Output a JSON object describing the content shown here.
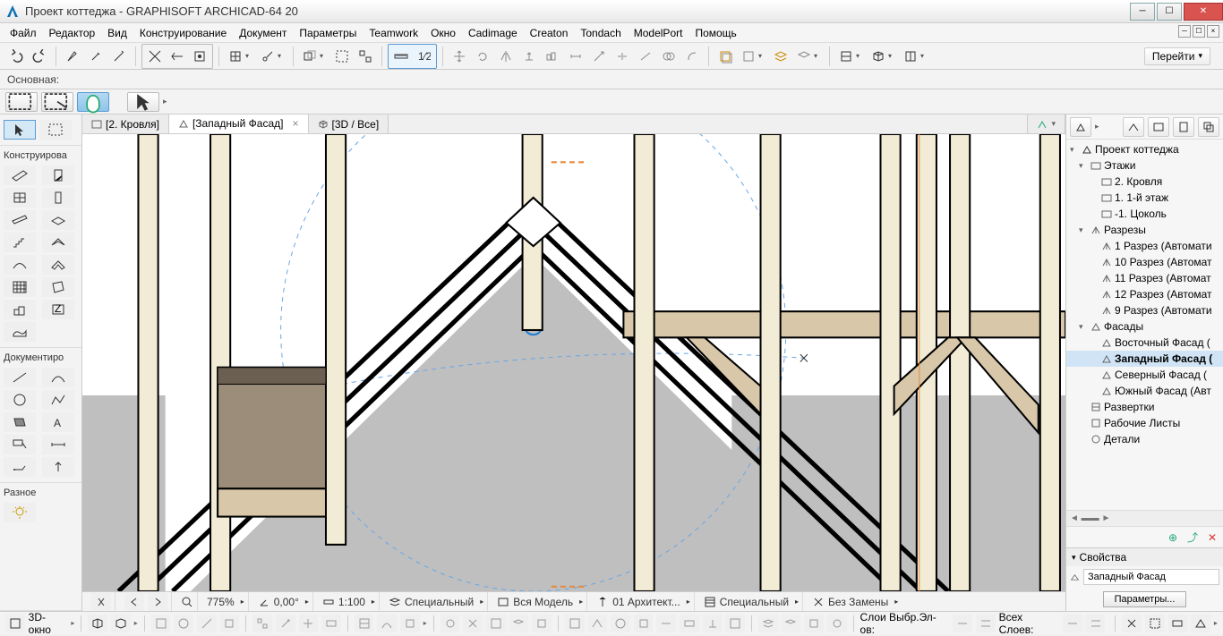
{
  "window": {
    "title": "Проект коттеджа - GRAPHISOFT ARCHICAD-64 20"
  },
  "menu": [
    "Файл",
    "Редактор",
    "Вид",
    "Конструирование",
    "Документ",
    "Параметры",
    "Teamwork",
    "Окно",
    "Cadimage",
    "Creaton",
    "Tondach",
    "ModelPort",
    "Помощь"
  ],
  "sub_toolbar": {
    "label": "Основная:"
  },
  "goto_label": "Перейти",
  "tabs": [
    {
      "label": "[2. Кровля]",
      "icon": "folder",
      "active": false
    },
    {
      "label": "[Западный Фасад]",
      "icon": "elevation",
      "active": true,
      "closable": true
    },
    {
      "label": "[3D / Все]",
      "icon": "cube",
      "active": false
    }
  ],
  "toolbox": {
    "sections": [
      {
        "title": "Конструирова"
      },
      {
        "title": "Документиро"
      },
      {
        "title": "Разное"
      }
    ]
  },
  "info_bar": {
    "zoom": "775%",
    "angle": "0,00°",
    "scale": "1:100",
    "layer_combo": "Специальный",
    "model_view": "Вся Модель",
    "arch_set": "01 Архитект...",
    "pen_set": "Специальный",
    "override": "Без Замены"
  },
  "bottom_bar": {
    "view_label": "3D-окно",
    "layers_label": "Слои Выбр.Эл-ов:",
    "all_layers_label": "Всех Слоев:"
  },
  "navigator": {
    "project": "Проект коттеджа",
    "tree": [
      {
        "label": "Этажи",
        "level": 1,
        "icon": "folder",
        "exp": "▾"
      },
      {
        "label": "2. Кровля",
        "level": 2,
        "icon": "story"
      },
      {
        "label": "1. 1-й этаж",
        "level": 2,
        "icon": "story"
      },
      {
        "label": "-1. Цоколь",
        "level": 2,
        "icon": "story"
      },
      {
        "label": "Разрезы",
        "level": 1,
        "icon": "section-folder",
        "exp": "▾"
      },
      {
        "label": "1 Разрез (Автомати",
        "level": 2,
        "icon": "section"
      },
      {
        "label": "10 Разрез (Автомат",
        "level": 2,
        "icon": "section"
      },
      {
        "label": "11 Разрез (Автомат",
        "level": 2,
        "icon": "section"
      },
      {
        "label": "12 Разрез (Автомат",
        "level": 2,
        "icon": "section"
      },
      {
        "label": "9 Разрез (Автомати",
        "level": 2,
        "icon": "section"
      },
      {
        "label": "Фасады",
        "level": 1,
        "icon": "elevation-folder",
        "exp": "▾"
      },
      {
        "label": "Восточный Фасад (",
        "level": 2,
        "icon": "elevation"
      },
      {
        "label": "Западный Фасад (",
        "level": 2,
        "icon": "elevation",
        "selected": true
      },
      {
        "label": "Северный Фасад (",
        "level": 2,
        "icon": "elevation"
      },
      {
        "label": "Южный Фасад (Авт",
        "level": 2,
        "icon": "elevation"
      },
      {
        "label": "Развертки",
        "level": 1,
        "icon": "interior"
      },
      {
        "label": "Рабочие Листы",
        "level": 1,
        "icon": "worksheet"
      },
      {
        "label": "Детали",
        "level": 1,
        "icon": "detail"
      }
    ],
    "props": {
      "header": "Свойства",
      "value": "Западный Фасад",
      "button": "Параметры..."
    }
  }
}
